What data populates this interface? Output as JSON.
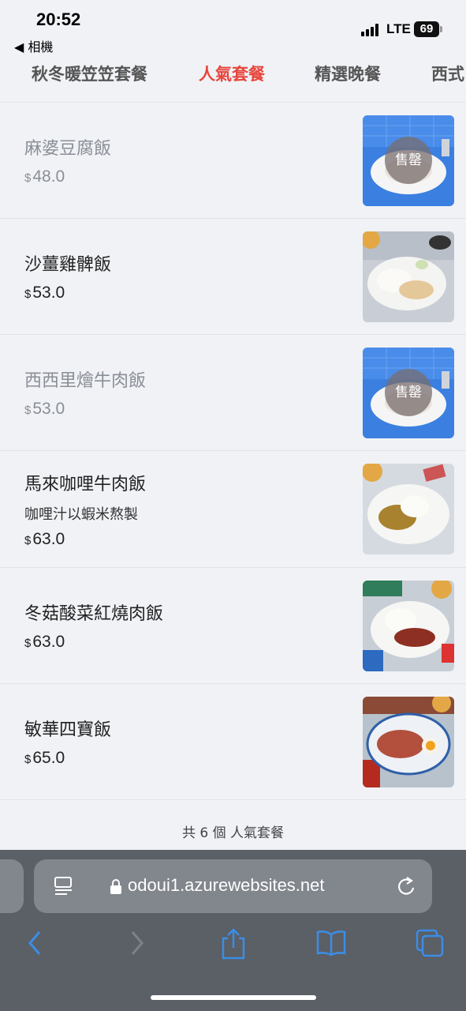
{
  "status_bar": {
    "time": "20:52",
    "back_app": "◀ 相機",
    "network": "LTE",
    "battery": "69"
  },
  "tabs": [
    {
      "label": "秋冬暖笠笠套餐",
      "active": false
    },
    {
      "label": "人氣套餐",
      "active": true
    },
    {
      "label": "精選晚餐",
      "active": false
    },
    {
      "label": "西式",
      "active": false
    }
  ],
  "menu": {
    "currency": "$",
    "sold_out_label": "售罄",
    "items": [
      {
        "name": "麻婆豆腐飯",
        "price": "48.0",
        "desc": "",
        "sold_out": true
      },
      {
        "name": "沙薑雞髀飯",
        "price": "53.0",
        "desc": "",
        "sold_out": false
      },
      {
        "name": "西西里燴牛肉飯",
        "price": "53.0",
        "desc": "",
        "sold_out": true
      },
      {
        "name": "馬來咖哩牛肉飯",
        "price": "63.0",
        "desc": "咖哩汁以蝦米熬製",
        "sold_out": false
      },
      {
        "name": "冬菇酸菜紅燒肉飯",
        "price": "63.0",
        "desc": "",
        "sold_out": false
      },
      {
        "name": "敏華四寶飯",
        "price": "65.0",
        "desc": "",
        "sold_out": false
      }
    ],
    "footer": "共 6 個 人氣套餐"
  },
  "browser": {
    "url": "odoui1.azurewebsites.net"
  },
  "colors": {
    "accent": "#e8453c",
    "safari_blue": "#3a8ee6"
  }
}
